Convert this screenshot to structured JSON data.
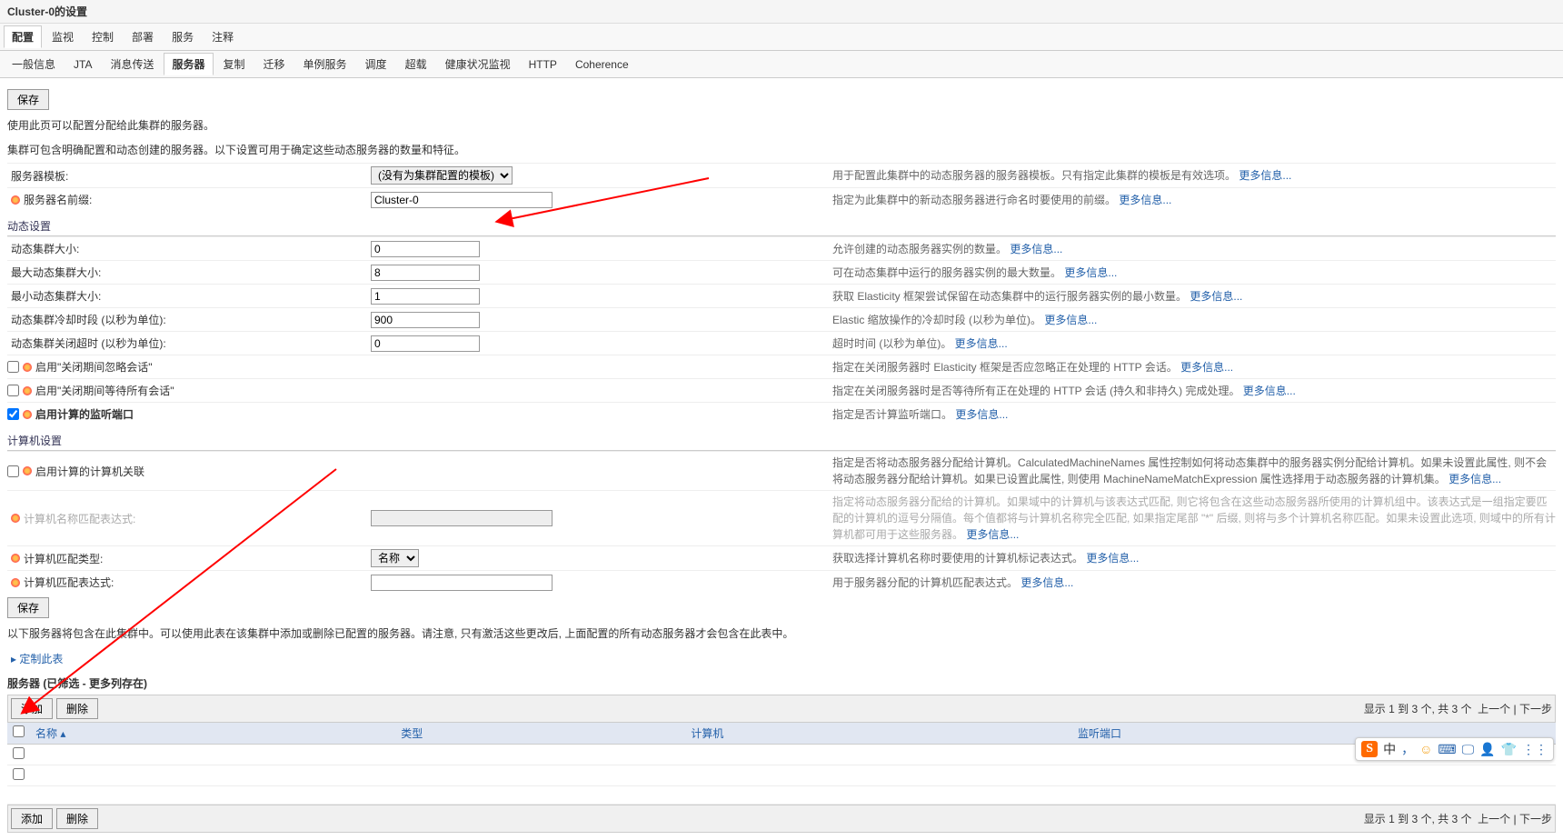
{
  "page_title": "Cluster-0的设置",
  "top_tabs": [
    "配置",
    "监视",
    "控制",
    "部署",
    "服务",
    "注释"
  ],
  "top_tabs_active": 0,
  "sub_tabs": [
    "一般信息",
    "JTA",
    "消息传送",
    "服务器",
    "复制",
    "迁移",
    "单例服务",
    "调度",
    "超载",
    "健康状况监视",
    "HTTP",
    "Coherence"
  ],
  "sub_tabs_active": 3,
  "buttons": {
    "save": "保存",
    "add": "添加",
    "delete": "删除",
    "customize": "定制此表"
  },
  "intro": {
    "l1": "使用此页可以配置分配给此集群的服务器。",
    "l2": "集群可包含明确配置和动态创建的服务器。以下设置可用于确定这些动态服务器的数量和特征。"
  },
  "more_info": "更多信息...",
  "fields": {
    "server_template": {
      "label": "服务器模板:",
      "option": "(没有为集群配置的模板)",
      "help": "用于配置此集群中的动态服务器的服务器模板。只有指定此集群的模板是有效选项。"
    },
    "server_name_prefix": {
      "label": "服务器名前缀:",
      "value": "Cluster-0",
      "help": "指定为此集群中的新动态服务器进行命名时要使用的前缀。"
    },
    "sec_dynamic": "动态设置",
    "dyn_size": {
      "label": "动态集群大小:",
      "value": "0",
      "help": "允许创建的动态服务器实例的数量。"
    },
    "max_dyn_size": {
      "label": "最大动态集群大小:",
      "value": "8",
      "help": "可在动态集群中运行的服务器实例的最大数量。"
    },
    "min_dyn_size": {
      "label": "最小动态集群大小:",
      "value": "1",
      "help": "获取 Elasticity 框架尝试保留在动态集群中的运行服务器实例的最小数量。"
    },
    "cooldown": {
      "label": "动态集群冷却时段 (以秒为单位):",
      "value": "900",
      "help": "Elastic 缩放操作的冷却时段 (以秒为单位)。"
    },
    "shutdown_timeout": {
      "label": "动态集群关闭超时 (以秒为单位):",
      "value": "0",
      "help": "超时时间 (以秒为单位)。"
    },
    "ignore_sessions": {
      "label": "启用\"关闭期间忽略会话\"",
      "help": "指定在关闭服务器时 Elasticity 框架是否应忽略正在处理的 HTTP 会话。"
    },
    "wait_sessions": {
      "label": "启用\"关闭期间等待所有会话\"",
      "help": "指定在关闭服务器时是否等待所有正在处理的 HTTP 会话 (持久和非持久) 完成处理。"
    },
    "calc_listen_port": {
      "label": "启用计算的监听端口",
      "help": "指定是否计算监听端口。",
      "checked": true
    },
    "sec_machine": "计算机设置",
    "calc_machine": {
      "label": "启用计算的计算机关联",
      "help": "指定是否将动态服务器分配给计算机。CalculatedMachineNames 属性控制如何将动态集群中的服务器实例分配给计算机。如果未设置此属性, 则不会将动态服务器分配给计算机。如果已设置此属性, 则使用 MachineNameMatchExpression 属性选择用于动态服务器的计算机集。"
    },
    "machine_match_expr": {
      "label": "计算机名称匹配表达式:",
      "disabled": true,
      "help_grey": "指定将动态服务器分配给的计算机。如果域中的计算机与该表达式匹配, 则它将包含在这些动态服务器所使用的计算机组中。该表达式是一组指定要匹配的计算机的逗号分隔值。每个值都将与计算机名称完全匹配, 如果指定尾部 \"*\" 后缀, 则将与多个计算机名称匹配。如果未设置此选项, 则域中的所有计算机都可用于这些服务器。"
    },
    "machine_match_type": {
      "label": "计算机匹配类型:",
      "option": "名称",
      "help": "获取选择计算机名称时要使用的计算机标记表达式。"
    },
    "machine_match_expr2": {
      "label": "计算机匹配表达式:",
      "help": "用于服务器分配的计算机匹配表达式。"
    }
  },
  "note": "以下服务器将包含在此集群中。可以使用此表在该集群中添加或删除已配置的服务器。请注意, 只有激活这些更改后, 上面配置的所有动态服务器才会包含在此表中。",
  "table": {
    "title": "服务器 (已筛选 - 更多列存在)",
    "cols": [
      "名称",
      "类型",
      "计算机",
      "监听端口"
    ],
    "range": "显示 1 到 3 个, 共 3 个",
    "prev": "上一个",
    "next": "下一步"
  },
  "ime": [
    "中",
    "，",
    "☺",
    "⌨",
    "🖵",
    "👤",
    "👕",
    "⋮⋮"
  ]
}
